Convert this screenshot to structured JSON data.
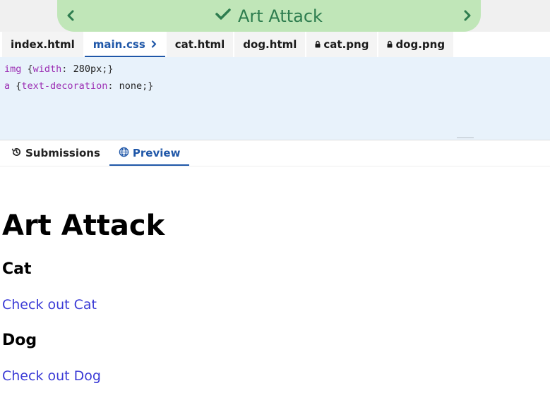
{
  "header": {
    "title": "Art Attack",
    "status_icon": "check-icon",
    "prev_icon": "chevron-left-icon",
    "next_icon": "chevron-right-icon",
    "accent_color": "#2e7d4f",
    "pill_color": "#c0e6b8"
  },
  "file_tabs": [
    {
      "label": "index.html",
      "locked": false,
      "active": false
    },
    {
      "label": "main.css",
      "locked": false,
      "active": true
    },
    {
      "label": "cat.html",
      "locked": false,
      "active": false
    },
    {
      "label": "dog.html",
      "locked": false,
      "active": false
    },
    {
      "label": "cat.png",
      "locked": true,
      "active": false
    },
    {
      "label": "dog.png",
      "locked": true,
      "active": false
    }
  ],
  "editor": {
    "lines": [
      {
        "selector": "img",
        "open": " {",
        "property": "width",
        "colon": ": ",
        "value": "280px",
        "close": ";}"
      },
      {
        "selector": "a",
        "open": " {",
        "property": "text-decoration",
        "colon": ": ",
        "value": "none",
        "close": ";}"
      }
    ],
    "background": "#e8f2fb"
  },
  "panel_tabs": [
    {
      "label": "Submissions",
      "icon": "history-icon",
      "active": false
    },
    {
      "label": "Preview",
      "icon": "globe-icon",
      "active": true
    }
  ],
  "preview": {
    "heading": "Art Attack",
    "sections": [
      {
        "title": "Cat",
        "link": "Check out Cat"
      },
      {
        "title": "Dog",
        "link": "Check out Dog"
      }
    ],
    "link_color": "#3b3bd6"
  }
}
